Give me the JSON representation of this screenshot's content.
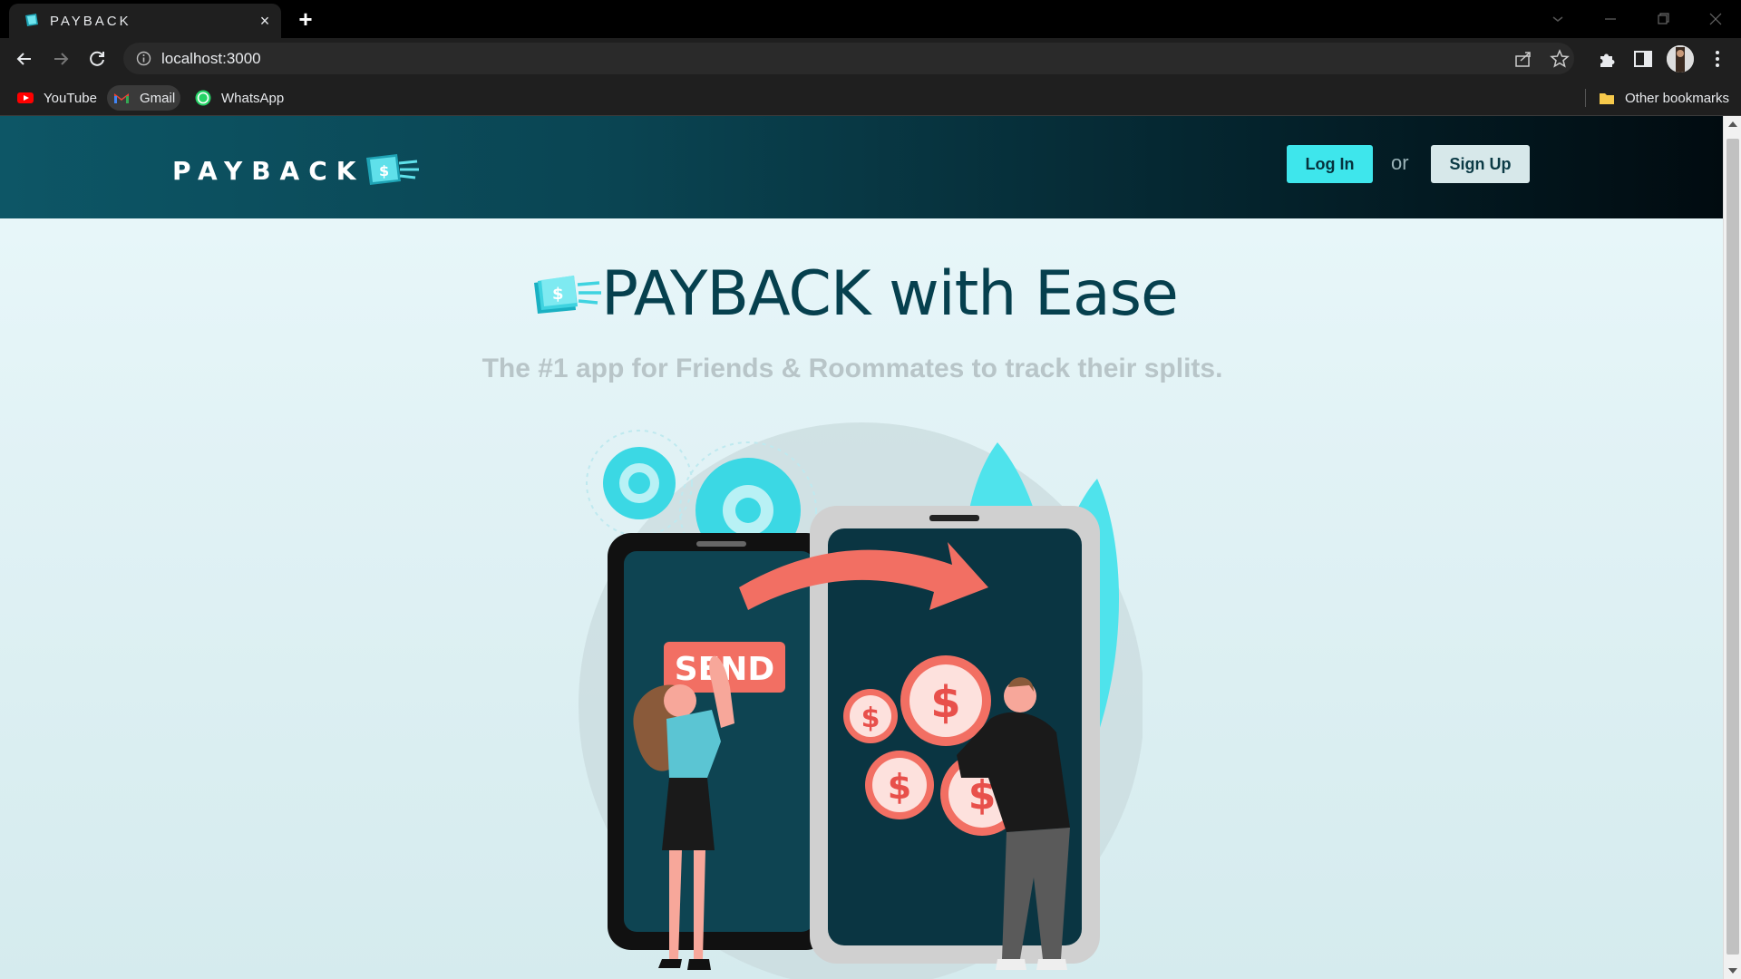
{
  "browser": {
    "tab_title": "PAYBACK",
    "tab_close": "×",
    "new_tab": "+",
    "url": "localhost:3000",
    "bookmarks": [
      {
        "label": "YouTube",
        "icon": "youtube-icon"
      },
      {
        "label": "Gmail",
        "icon": "gmail-icon"
      },
      {
        "label": "WhatsApp",
        "icon": "whatsapp-icon"
      }
    ],
    "other_bookmarks": "Other bookmarks"
  },
  "header": {
    "brand": "PAYBACK",
    "login_label": "Log In",
    "or_label": "or",
    "signup_label": "Sign Up"
  },
  "hero": {
    "title": "PAYBACK with Ease",
    "subtitle": "The #1 app for Friends & Roommates to track their splits.",
    "send_label": "SEND",
    "dollar_glyph": "$"
  },
  "colors": {
    "accent": "#3ee6ec",
    "title": "#06404e",
    "header_dark": "#04212a",
    "coral": "#f26f63"
  }
}
